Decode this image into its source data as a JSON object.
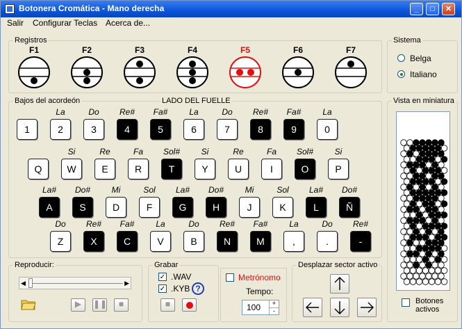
{
  "window": {
    "title": "Botonera Cromática - Mano derecha"
  },
  "menu": [
    "Salir",
    "Configurar Teclas",
    "Acerca de..."
  ],
  "registros": {
    "label": "Registros",
    "items": [
      {
        "key": "F1",
        "active": false
      },
      {
        "key": "F2",
        "active": false
      },
      {
        "key": "F3",
        "active": false
      },
      {
        "key": "F4",
        "active": false
      },
      {
        "key": "F5",
        "active": true
      },
      {
        "key": "F6",
        "active": false
      },
      {
        "key": "F7",
        "active": false
      }
    ]
  },
  "sistema": {
    "label": "Sistema",
    "options": [
      "Belga",
      "Italiano"
    ],
    "selected": "Italiano"
  },
  "bajos": {
    "label": "Bajos del acordeón",
    "center_label": "LADO DEL FUELLE",
    "rows": [
      {
        "notes": [
          "",
          "La",
          "Do",
          "Re#",
          "Fa#",
          "La",
          "Do",
          "Re#",
          "Fa#",
          "La"
        ],
        "keys": [
          {
            "k": "1",
            "dark": false
          },
          {
            "k": "2",
            "dark": false
          },
          {
            "k": "3",
            "dark": false
          },
          {
            "k": "4",
            "dark": true
          },
          {
            "k": "5",
            "dark": true
          },
          {
            "k": "6",
            "dark": false
          },
          {
            "k": "7",
            "dark": false
          },
          {
            "k": "8",
            "dark": true
          },
          {
            "k": "9",
            "dark": true
          },
          {
            "k": "0",
            "dark": false
          }
        ]
      },
      {
        "notes": [
          "",
          "Si",
          "Re",
          "Fa",
          "Sol#",
          "Si",
          "Re",
          "Fa",
          "Sol#",
          "Si"
        ],
        "keys": [
          {
            "k": "Q",
            "dark": false
          },
          {
            "k": "W",
            "dark": false
          },
          {
            "k": "E",
            "dark": false
          },
          {
            "k": "R",
            "dark": false
          },
          {
            "k": "T",
            "dark": true
          },
          {
            "k": "Y",
            "dark": false
          },
          {
            "k": "U",
            "dark": false
          },
          {
            "k": "I",
            "dark": false
          },
          {
            "k": "O",
            "dark": true
          },
          {
            "k": "P",
            "dark": false
          }
        ]
      },
      {
        "notes": [
          "La#",
          "Do#",
          "Mi",
          "Sol",
          "La#",
          "Do#",
          "Mi",
          "Sol",
          "La#",
          "Do#"
        ],
        "keys": [
          {
            "k": "A",
            "dark": true
          },
          {
            "k": "S",
            "dark": true
          },
          {
            "k": "D",
            "dark": false
          },
          {
            "k": "F",
            "dark": false
          },
          {
            "k": "G",
            "dark": true
          },
          {
            "k": "H",
            "dark": true
          },
          {
            "k": "J",
            "dark": false
          },
          {
            "k": "K",
            "dark": false
          },
          {
            "k": "L",
            "dark": true
          },
          {
            "k": "Ñ",
            "dark": true
          }
        ]
      },
      {
        "notes": [
          "Do",
          "Re#",
          "Fa#",
          "La",
          "Do",
          "Re#",
          "Fa#",
          "La",
          "Do",
          "Re#"
        ],
        "keys": [
          {
            "k": "Z",
            "dark": false
          },
          {
            "k": "X",
            "dark": true
          },
          {
            "k": "C",
            "dark": true
          },
          {
            "k": "V",
            "dark": false
          },
          {
            "k": "B",
            "dark": false
          },
          {
            "k": "N",
            "dark": true
          },
          {
            "k": "M",
            "dark": true
          },
          {
            "k": ",",
            "dark": false
          },
          {
            "k": ".",
            "dark": false
          },
          {
            "k": "-",
            "dark": true
          }
        ]
      }
    ]
  },
  "vista": {
    "label": "Vista en miniatura",
    "botones_activos": "Botones activos",
    "botones_activos_checked": false
  },
  "reproducir": {
    "label": "Reproducir:"
  },
  "grabar": {
    "label": "Grabar",
    "wav": ".WAV",
    "kyb": ".KYB",
    "wav_checked": true,
    "kyb_checked": true,
    "help": "?"
  },
  "metronomo": {
    "label": "Metrónomo",
    "checked": false,
    "tempo_label": "Tempo:",
    "tempo": "100"
  },
  "desplazar": {
    "label": "Desplazar sector activo"
  },
  "colors": {
    "accent_red": "#e01010",
    "title_blue": "#0a55d8"
  }
}
